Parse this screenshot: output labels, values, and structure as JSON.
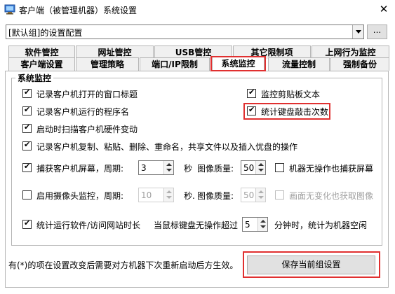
{
  "window": {
    "title": "客户端（被管理机器）系统设置",
    "app_icon": "monitor-app-icon",
    "close_glyph": "✕"
  },
  "group_selector": {
    "value": "[默认组]的设置配置",
    "more_label": "..."
  },
  "tabs_row_back": [
    {
      "label": "软件管控"
    },
    {
      "label": "网址管控"
    },
    {
      "label": "USB管控"
    },
    {
      "label": "其它限制项"
    },
    {
      "label": "上网行为监控"
    }
  ],
  "tabs_row_front": [
    {
      "label": "客户端设置"
    },
    {
      "label": "管理策略"
    },
    {
      "label": "端口/IP限制"
    },
    {
      "label": "系统监控"
    },
    {
      "label": "流量控制"
    },
    {
      "label": "强制备份"
    }
  ],
  "active_tab": "系统监控",
  "group": {
    "legend": "系统监控",
    "options": [
      {
        "label": "记录客户机打开的窗口标题",
        "checked": true
      },
      {
        "label": "监控剪贴板文本",
        "checked": true
      },
      {
        "label": "记录客户机运行的程序名",
        "checked": true
      },
      {
        "label": "统计键盘敲击次数",
        "checked": true
      },
      {
        "label": "启动时扫描客户机硬件变动",
        "checked": true
      },
      {
        "label": "记录客户机复制、粘贴、删除、重命名，共享文件以及插入优盘的操作",
        "checked": true
      }
    ],
    "screen_capture": {
      "label": "捕获客户机屏幕，周期:",
      "checked": true,
      "period": "3",
      "unit": "秒",
      "quality_label": "图像质量:",
      "quality": "50",
      "idle_label": "机器无操作也捕获屏幕",
      "idle_checked": false
    },
    "camera": {
      "label": "启用摄像头监控，周期:",
      "checked": false,
      "period": "10",
      "unit": "秒.",
      "quality_label": "图像质量:",
      "quality": "50",
      "nochange_label": "画面无变化也获取图像",
      "nochange_checked": false
    },
    "usage_stats": {
      "label": "统计运行软件/访问网站时长",
      "checked": true,
      "idle_prefix": "当鼠标键盘无操作超过",
      "idle_minutes": "5",
      "idle_suffix": "分钟时，统计为机器空闲"
    }
  },
  "footer": {
    "note": "有(*)的项在设置改变后需要对方机器下次重新启动后方生效。",
    "save_label": "保存当前组设置"
  },
  "colors": {
    "highlight": "#e03030",
    "tab_bg": "#f0f0f0",
    "button_bg": "#e1e1e1"
  }
}
